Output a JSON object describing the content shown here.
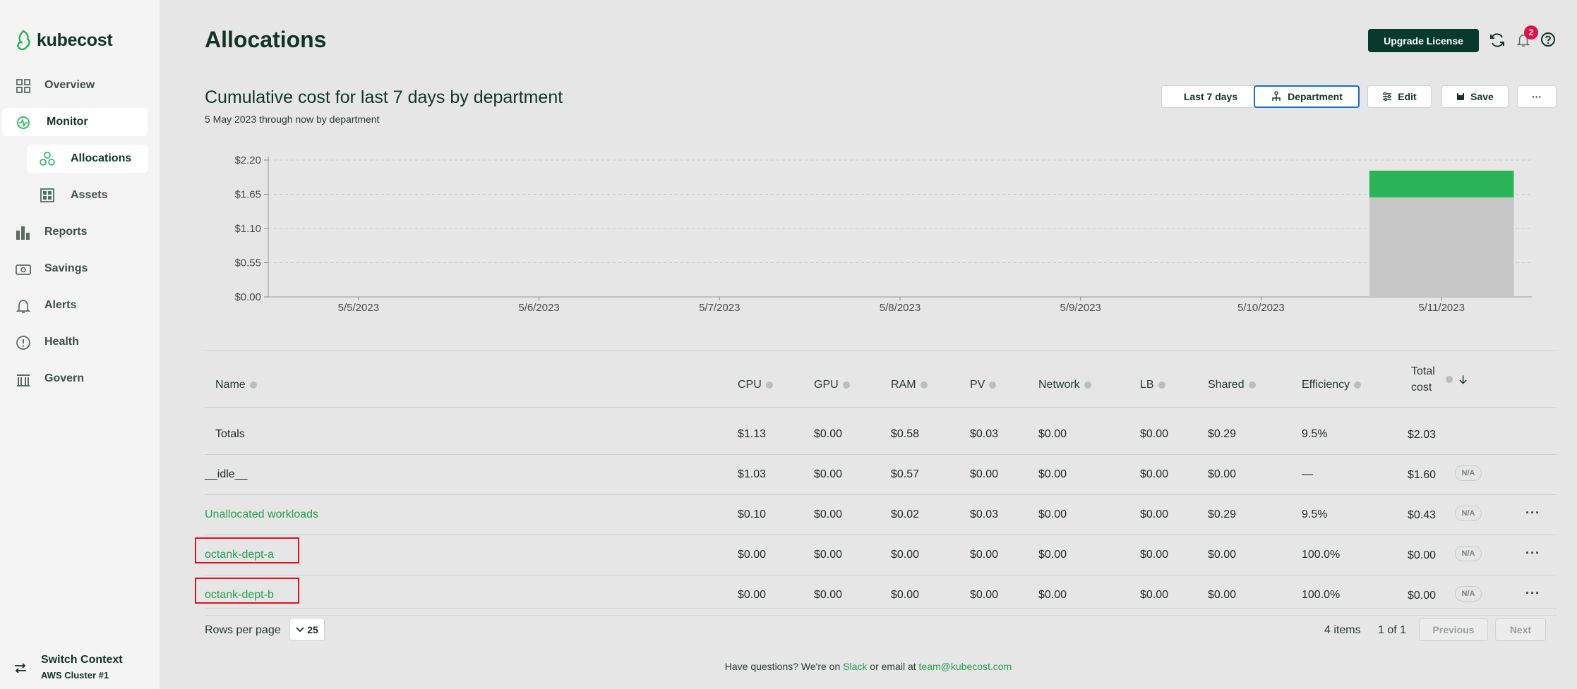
{
  "app": {
    "name": "kubecost"
  },
  "sidebar": {
    "items": [
      {
        "label": "Overview",
        "icon": "grid-icon"
      },
      {
        "label": "Monitor",
        "icon": "monitor-icon"
      },
      {
        "label": "Allocations",
        "icon": "allocations-icon"
      },
      {
        "label": "Assets",
        "icon": "assets-icon"
      },
      {
        "label": "Reports",
        "icon": "bar-chart-icon"
      },
      {
        "label": "Savings",
        "icon": "savings-icon"
      },
      {
        "label": "Alerts",
        "icon": "bell-icon"
      },
      {
        "label": "Health",
        "icon": "health-icon"
      },
      {
        "label": "Govern",
        "icon": "govern-icon"
      }
    ],
    "switch_context": {
      "title": "Switch Context",
      "cluster": "AWS Cluster #1"
    }
  },
  "header": {
    "title": "Allocations",
    "upgrade_label": "Upgrade License",
    "notification_count": "2"
  },
  "chart_header": {
    "title": "Cumulative cost for last 7 days by department",
    "subtitle": "5 May 2023 through now by department"
  },
  "controls": {
    "range_label": "Last 7 days",
    "aggregate_label": "Department",
    "edit_label": "Edit",
    "save_label": "Save",
    "more_label": "···"
  },
  "chart_data": {
    "type": "bar",
    "categories": [
      "5/5/2023",
      "5/6/2023",
      "5/7/2023",
      "5/8/2023",
      "5/9/2023",
      "5/10/2023",
      "5/11/2023"
    ],
    "y_ticks": [
      "$0.00",
      "$0.55",
      "$1.10",
      "$1.65",
      "$2.20"
    ],
    "ylim": [
      0,
      2.2
    ],
    "grid": true,
    "stacked": true,
    "series": [
      {
        "values": [
          0,
          0,
          0,
          0,
          0,
          0,
          1.6
        ],
        "color": "#c6c6c6"
      },
      {
        "values": [
          0,
          0,
          0,
          0,
          0,
          0,
          0.43
        ],
        "color": "#29b557"
      }
    ]
  },
  "table": {
    "headers": [
      "Name",
      "CPU",
      "GPU",
      "RAM",
      "PV",
      "Network",
      "LB",
      "Shared",
      "Efficiency",
      "Total cost"
    ],
    "totals": {
      "name": "Totals",
      "cpu": "$1.13",
      "gpu": "$0.00",
      "ram": "$0.58",
      "pv": "$0.03",
      "network": "$0.00",
      "lb": "$0.00",
      "shared": "$0.29",
      "efficiency": "9.5%",
      "total": "$2.03"
    },
    "rows": [
      {
        "name": "__idle__",
        "cpu": "$1.03",
        "gpu": "$0.00",
        "ram": "$0.57",
        "pv": "$0.00",
        "network": "$0.00",
        "lb": "$0.00",
        "shared": "$0.00",
        "efficiency": "—",
        "total": "$1.60",
        "badge": "N/A"
      },
      {
        "name": "Unallocated workloads",
        "cpu": "$0.10",
        "gpu": "$0.00",
        "ram": "$0.02",
        "pv": "$0.03",
        "network": "$0.00",
        "lb": "$0.00",
        "shared": "$0.29",
        "efficiency": "9.5%",
        "total": "$0.43",
        "badge": "N/A"
      },
      {
        "name": "octank-dept-a",
        "cpu": "$0.00",
        "gpu": "$0.00",
        "ram": "$0.00",
        "pv": "$0.00",
        "network": "$0.00",
        "lb": "$0.00",
        "shared": "$0.00",
        "efficiency": "100.0%",
        "total": "$0.00",
        "badge": "N/A"
      },
      {
        "name": "octank-dept-b",
        "cpu": "$0.00",
        "gpu": "$0.00",
        "ram": "$0.00",
        "pv": "$0.00",
        "network": "$0.00",
        "lb": "$0.00",
        "shared": "$0.00",
        "efficiency": "100.0%",
        "total": "$0.00",
        "badge": "N/A"
      }
    ]
  },
  "pagination": {
    "rows_per_page_label": "Rows per page",
    "rows_per_page": "25",
    "items": "4 items",
    "page": "1 of 1",
    "previous": "Previous",
    "next": "Next"
  },
  "footer": {
    "prefix": "Have questions? We're on ",
    "slack": "Slack",
    "middle": " or email at ",
    "email": "team@kubecost.com"
  },
  "colors": {
    "brand": "#073a2a",
    "accent": "#25a04d",
    "badge": "#e0124c",
    "highlight": "#e0141e"
  }
}
